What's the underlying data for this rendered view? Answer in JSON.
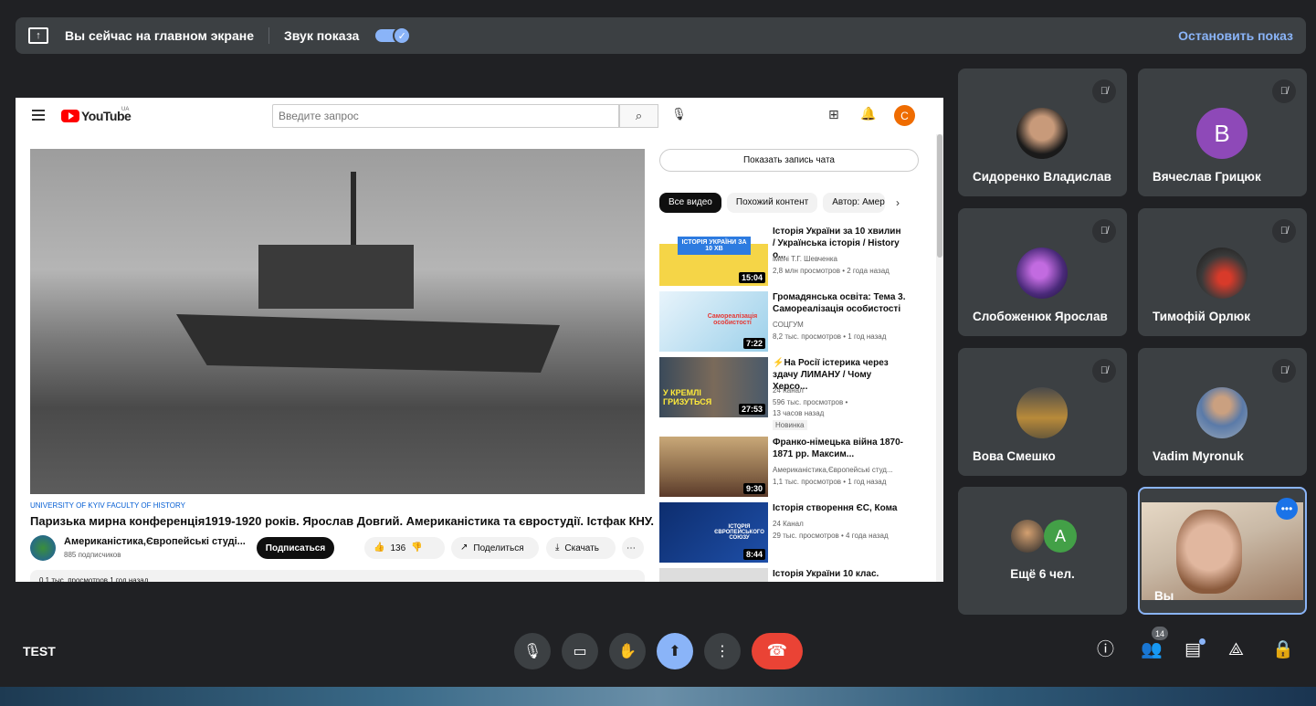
{
  "present_bar": {
    "title": "Вы сейчас на главном экране",
    "sound_label": "Звук показа",
    "sound_on": true,
    "stop_label": "Остановить показ"
  },
  "youtube": {
    "logo_text": "YouTube",
    "region": "UA",
    "search_placeholder": "Введите запрос",
    "avatar_letter": "С",
    "chat_button": "Показать запись чата",
    "chips": [
      "Все видео",
      "Похожий контент",
      "Автор: Амер"
    ],
    "video": {
      "channel_tag": "UNIVERSITY OF KYIV FACULTY OF HISTORY",
      "title": "Паризька мирна конференція1919-1920 років. Ярослав Довгий. Американістика та євростудії. Істфак КНУ.",
      "channel": "Американістика,Європейські студі...",
      "subscribers": "885 подписчиков",
      "subscribe_label": "Подписаться",
      "likes": "136",
      "share_label": "Поделиться",
      "download_label": "Скачать",
      "description_snippet": "0,1 тыс. просмотров  1 год назад"
    },
    "recommendations": [
      {
        "title": "Історія України за 10 хвилин / Українська історія / History o...",
        "channel": "імені Т.Г. Шевченка",
        "meta": "2,8 млн просмотров • 2 года назад",
        "duration": "15:04",
        "thumb_text": "ІСТОРІЯ УКРАЇНИ ЗА 10 ХВ"
      },
      {
        "title": "Громадянська освіта: Тема 3. Самореалізація особистості",
        "channel": "СОЦГУМ",
        "meta": "8,2 тыс. просмотров • 1 год назад",
        "duration": "7:22",
        "thumb_text": "Самореалізація особистості"
      },
      {
        "title": "⚡На Росії істерика через здачу ЛИМАНУ / Чому Херсо...",
        "channel": "24 Канал",
        "meta": "596 тыс. просмотров •",
        "meta2": "13 часов назад",
        "badge": "Новинка",
        "duration": "27:53",
        "thumb_text": "У КРЕМЛІ ГРИЗУТЬСЯ"
      },
      {
        "title": "Франко-німецька війна 1870-1871 рр. Максим...",
        "channel": "Американістика,Європейські студ...",
        "meta": "1,1 тыс. просмотров • 1 год назад",
        "duration": "9:30"
      },
      {
        "title": "Історія створення ЄС, Кома",
        "channel": "24 Канал",
        "meta": "29 тыс. просмотров • 4 года назад",
        "duration": "8:44",
        "thumb_text": "ІСТОРІЯ ЄВРОПЕЙСЬКОГО СОЮЗУ"
      },
      {
        "title": "Історія України 10 клас.",
        "channel": "",
        "meta": ""
      }
    ]
  },
  "participants": [
    {
      "name": "Сидоренко Владислав",
      "avatar_letter": "",
      "avatar_color": "#2b2b2b"
    },
    {
      "name": "Вячеслав Грицюк",
      "avatar_letter": "В",
      "avatar_color": "#8e49b8"
    },
    {
      "name": "Слобоженюк Ярослав",
      "avatar_letter": "",
      "avatar_color": "#6a3fa0"
    },
    {
      "name": "Тимофій Орлюк",
      "avatar_letter": "",
      "avatar_color": "#3a2a2a"
    },
    {
      "name": "Вова Смешко",
      "avatar_letter": "",
      "avatar_color": "#8a6a3a"
    },
    {
      "name": "Vadim Myronuk",
      "avatar_letter": "",
      "avatar_color": "#7a8a9a"
    }
  ],
  "more_tile": {
    "label": "Ещё 6 чел.",
    "avatar_letter": "A"
  },
  "self_tile": {
    "label": "Вы"
  },
  "meeting": {
    "name": "TEST",
    "participant_count": "14"
  }
}
